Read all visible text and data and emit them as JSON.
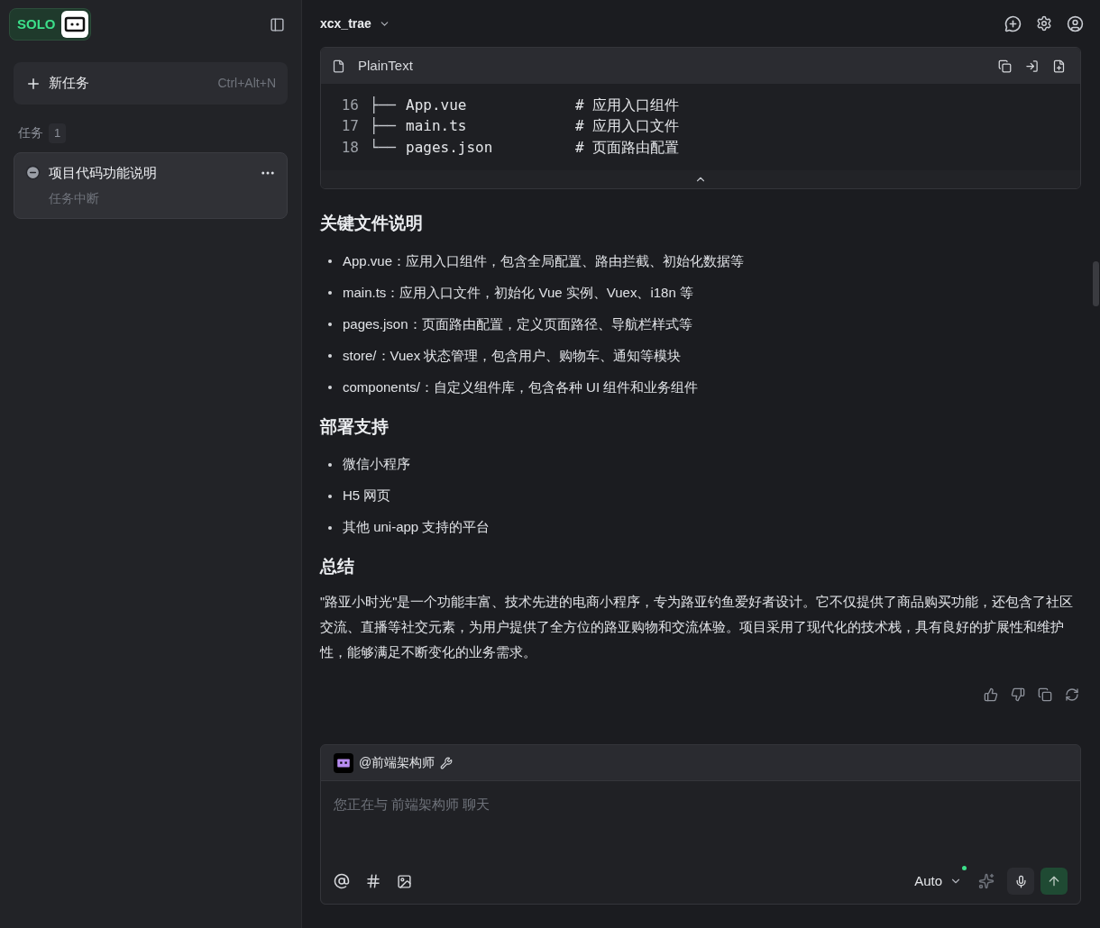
{
  "sidebar": {
    "logo": {
      "text": "SOLO"
    },
    "new_task": {
      "label": "新任务",
      "shortcut": "Ctrl+Alt+N"
    },
    "section": {
      "label": "任务",
      "count": "1"
    },
    "tasks": [
      {
        "title": "项目代码功能说明",
        "status": "任务中断",
        "selected": true
      }
    ]
  },
  "header": {
    "project": "xcx_trae"
  },
  "code_block": {
    "language": "PlainText",
    "lines": [
      {
        "number": "16",
        "tree": "├──",
        "name": "App.vue",
        "comment": "# 应用入口组件"
      },
      {
        "number": "17",
        "tree": "├──",
        "name": "main.ts",
        "comment": "# 应用入口文件"
      },
      {
        "number": "18",
        "tree": "└──",
        "name": "pages.json",
        "comment": "# 页面路由配置"
      }
    ]
  },
  "sections": [
    {
      "heading": "关键文件说明",
      "kind": "list",
      "items": [
        "App.vue：应用入口组件，包含全局配置、路由拦截、初始化数据等",
        "main.ts：应用入口文件，初始化 Vue 实例、Vuex、i18n 等",
        "pages.json：页面路由配置，定义页面路径、导航栏样式等",
        "store/：Vuex 状态管理，包含用户、购物车、通知等模块",
        "components/：自定义组件库，包含各种 UI 组件和业务组件"
      ]
    },
    {
      "heading": "部署支持",
      "kind": "list",
      "items": [
        "微信小程序",
        "H5 网页",
        "其他 uni-app 支持的平台"
      ]
    },
    {
      "heading": "总结",
      "kind": "paragraph",
      "text": "\"路亚小时光\"是一个功能丰富、技术先进的电商小程序，专为路亚钓鱼爱好者设计。它不仅提供了商品购买功能，还包含了社区交流、直播等社交元素，为用户提供了全方位的路亚购物和交流体验。项目采用了现代化的技术栈，具有良好的扩展性和维护性，能够满足不断变化的业务需求。"
    }
  ],
  "composer": {
    "agent": "@前端架构师",
    "placeholder": "您正在与 前端架构师 聊天",
    "model": "Auto",
    "model_online": true
  }
}
